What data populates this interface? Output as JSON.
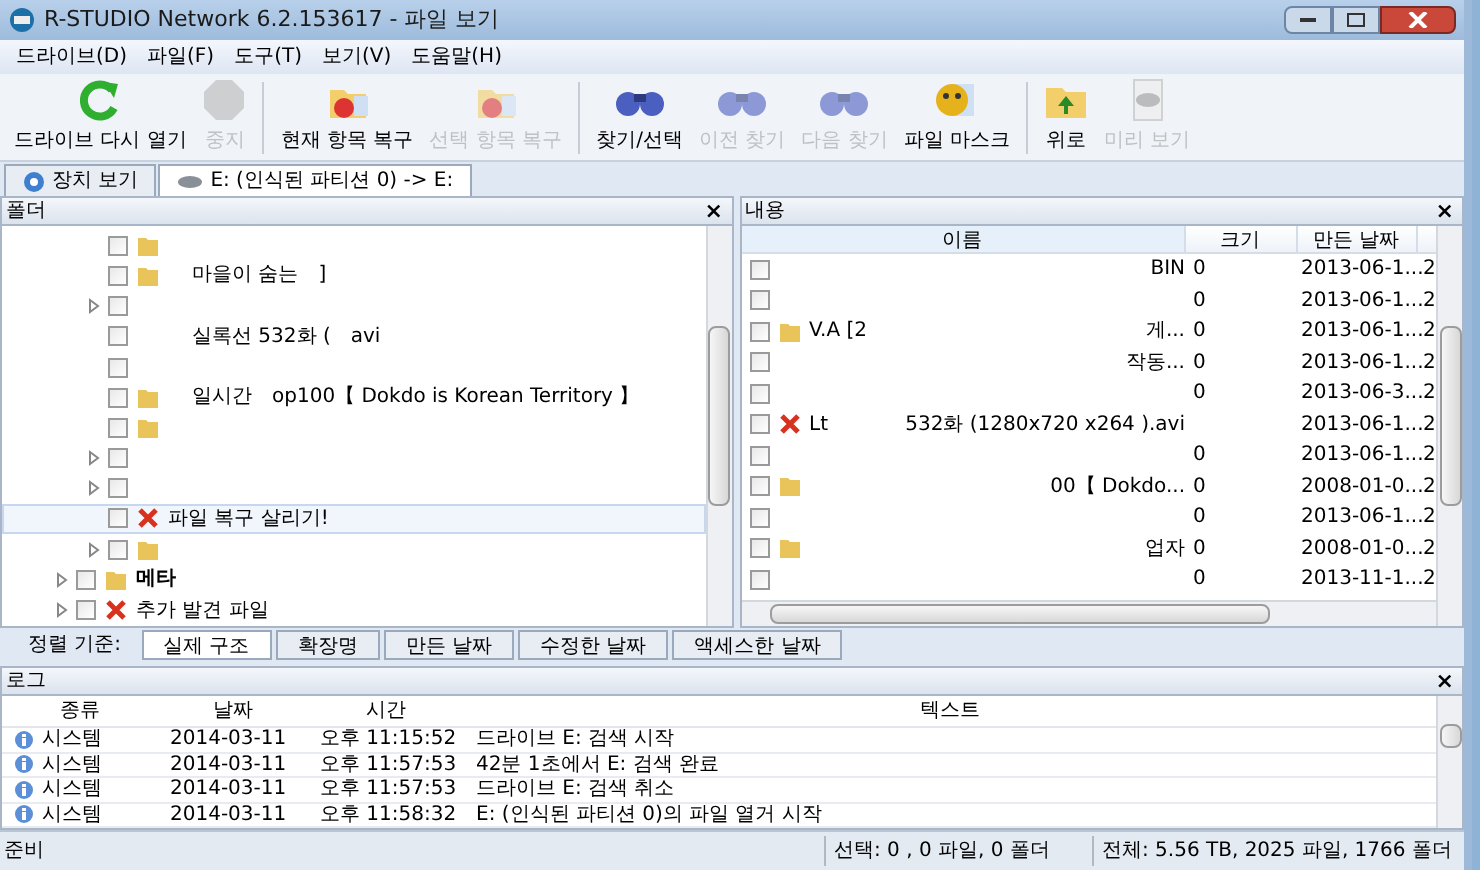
{
  "window": {
    "title": "R-STUDIO Network 6.2.153617 - 파일 보기"
  },
  "menu": [
    "드라이브(D)",
    "파일(F)",
    "도구(T)",
    "보기(V)",
    "도움말(H)"
  ],
  "toolbar": [
    {
      "kind": "button",
      "label": "드라이브 다시 열기",
      "disabled": false
    },
    {
      "kind": "button",
      "label": "중지",
      "disabled": true
    },
    {
      "kind": "sep"
    },
    {
      "kind": "button",
      "label": "현재 항목 복구",
      "disabled": false
    },
    {
      "kind": "button",
      "label": "선택 항목 복구",
      "disabled": true
    },
    {
      "kind": "sep"
    },
    {
      "kind": "button",
      "label": "찾기/선택",
      "disabled": false
    },
    {
      "kind": "button",
      "label": "이전 찾기",
      "disabled": true
    },
    {
      "kind": "button",
      "label": "다음 찾기",
      "disabled": true
    },
    {
      "kind": "button",
      "label": "파일 마스크",
      "disabled": false
    },
    {
      "kind": "sep"
    },
    {
      "kind": "button",
      "label": "위로",
      "disabled": false
    },
    {
      "kind": "button",
      "label": "미리 보기",
      "disabled": true
    }
  ],
  "tabs": [
    {
      "label": "장치 보기",
      "selected": false
    },
    {
      "label": "E: (인식된 파티션 0) -> E:",
      "selected": true
    }
  ],
  "folder_pane": {
    "title": "폴더",
    "close": "×",
    "items": [
      {
        "kind": "folder",
        "expandable": false,
        "checked": false,
        "selected": false
      },
      {
        "kind": "folder",
        "expandable": false,
        "checked": false,
        "selected": false,
        "fragments": [
          "마을이 숨는",
          "]"
        ]
      },
      {
        "kind": "file",
        "expandable": true,
        "checked": false,
        "selected": false
      },
      {
        "kind": "file",
        "expandable": false,
        "checked": false,
        "selected": false,
        "fragments": [
          "실록선 532화 (",
          "avi"
        ]
      },
      {
        "kind": "file",
        "expandable": false,
        "checked": false,
        "selected": false
      },
      {
        "kind": "folder",
        "expandable": false,
        "checked": false,
        "selected": false,
        "fragments": [
          "일시간",
          "op100【 Dokdo is Korean Territory 】"
        ]
      },
      {
        "kind": "folder",
        "expandable": false,
        "checked": false,
        "selected": false
      },
      {
        "kind": "file",
        "expandable": true,
        "checked": false,
        "selected": false
      },
      {
        "kind": "file",
        "expandable": true,
        "checked": false,
        "selected": false
      },
      {
        "kind": "deleted",
        "expandable": false,
        "checked": false,
        "selected": true,
        "fragments": [
          "파일 복구 살리기!"
        ]
      },
      {
        "kind": "folder",
        "expandable": true,
        "checked": false,
        "selected": false
      }
    ],
    "root_items": [
      {
        "kind": "folder",
        "expandable": true,
        "checked": false,
        "selected": false,
        "fragments": [
          "메타"
        ]
      },
      {
        "kind": "deleted",
        "expandable": true,
        "checked": false,
        "selected": false,
        "fragments": [
          "추가 발견 파일"
        ]
      }
    ]
  },
  "sort_by": {
    "label": "정렬 기준:",
    "tabs": [
      {
        "label": "실제 구조",
        "selected": true
      },
      {
        "label": "확장명",
        "selected": false
      },
      {
        "label": "만든 날짜",
        "selected": false
      },
      {
        "label": "수정한 날짜",
        "selected": false
      },
      {
        "label": "액세스한 날짜",
        "selected": false
      }
    ]
  },
  "content_pane": {
    "title": "내용",
    "close": "×",
    "columns": [
      "이름",
      "크기",
      "만든 날짜"
    ],
    "rows": [
      {
        "kind": "file",
        "checked": false,
        "fragments": [
          "BIN"
        ],
        "size": "0",
        "created": "2013-06-1...",
        "column_4": "2"
      },
      {
        "kind": "file",
        "checked": false,
        "size": "0",
        "created": "2013-06-1...",
        "column_4": "2"
      },
      {
        "kind": "folder",
        "checked": false,
        "fragments": [
          "V.A [2",
          "게..."
        ],
        "size": "0",
        "created": "2013-06-1...",
        "column_4": "2"
      },
      {
        "kind": "file",
        "checked": false,
        "fragments": [
          "작동..."
        ],
        "size": "0",
        "created": "2013-06-1...",
        "column_4": "2"
      },
      {
        "kind": "file",
        "checked": false,
        "size": "0",
        "created": "2013-06-3...",
        "column_4": "2"
      },
      {
        "kind": "deleted",
        "checked": false,
        "fragments": [
          "Lt",
          "532화 (1280x720 x264 ).avi"
        ],
        "created": "2013-06-1...",
        "column_4": "2"
      },
      {
        "kind": "file",
        "checked": false,
        "size": "0",
        "created": "2013-06-1...",
        "column_4": "2"
      },
      {
        "kind": "folder",
        "checked": false,
        "fragments": [
          "00【 Dokdo..."
        ],
        "size": "0",
        "created": "2008-01-0...",
        "column_4": "2"
      },
      {
        "kind": "file",
        "checked": false,
        "size": "0",
        "created": "2013-06-1...",
        "column_4": "2"
      },
      {
        "kind": "folder",
        "checked": false,
        "fragments": [
          "업자"
        ],
        "size": "0",
        "created": "2008-01-0...",
        "column_4": "2"
      },
      {
        "kind": "file",
        "checked": false,
        "size": "0",
        "created": "2013-11-1...",
        "column_4": "2"
      }
    ]
  },
  "log": {
    "title": "로그",
    "close": "×",
    "columns": [
      "종류",
      "날짜",
      "시간",
      "텍스트"
    ],
    "rows": [
      {
        "type": "시스템",
        "date": "2014-03-11",
        "time": "오후 11:15:52",
        "text": "드라이브 E: 검색 시작"
      },
      {
        "type": "시스템",
        "date": "2014-03-11",
        "time": "오후 11:57:53",
        "text": "42분 1초에서 E: 검색 완료"
      },
      {
        "type": "시스템",
        "date": "2014-03-11",
        "time": "오후 11:57:53",
        "text": "드라이브 E: 검색 취소"
      },
      {
        "type": "시스템",
        "date": "2014-03-11",
        "time": "오후 11:58:32",
        "text": "E: (인식된 파티션 0)의 파일 열거 시작"
      }
    ]
  },
  "status_bar": {
    "state": "준비",
    "selection": "선택: 0 , 0 파일, 0 폴더",
    "total": "전체: 5.56 TB, 2025 파일, 1766 폴더"
  }
}
